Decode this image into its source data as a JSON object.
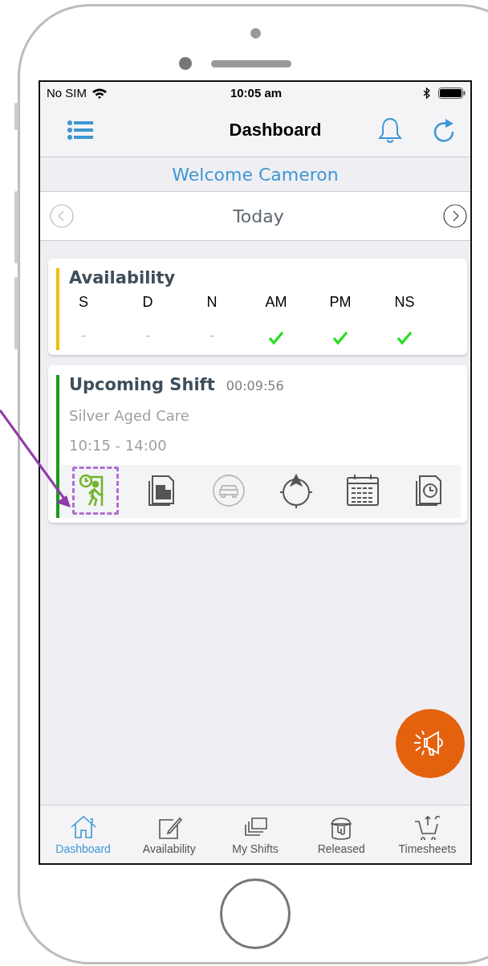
{
  "status_bar": {
    "carrier": "No SIM",
    "time": "10:05 am"
  },
  "nav_bar": {
    "title": "Dashboard"
  },
  "welcome": "Welcome Cameron",
  "date_nav": {
    "label": "Today"
  },
  "availability": {
    "title": "Availability",
    "columns": [
      {
        "label": "S",
        "available": false,
        "mark": "-"
      },
      {
        "label": "D",
        "available": false,
        "mark": "-"
      },
      {
        "label": "N",
        "available": false,
        "mark": "-"
      },
      {
        "label": "AM",
        "available": true
      },
      {
        "label": "PM",
        "available": true
      },
      {
        "label": "NS",
        "available": true
      }
    ]
  },
  "upcoming_shift": {
    "title": "Upcoming Shift",
    "countdown": "00:09:56",
    "location": "Silver Aged Care",
    "time": "10:15 - 14:00",
    "actions": [
      {
        "kind": "check-in",
        "disabled": false,
        "highlighted": true
      },
      {
        "kind": "documents",
        "disabled": false,
        "highlighted": false
      },
      {
        "kind": "car",
        "disabled": true,
        "highlighted": false
      },
      {
        "kind": "navigate",
        "disabled": false,
        "highlighted": false
      },
      {
        "kind": "calendar",
        "disabled": false,
        "highlighted": false
      },
      {
        "kind": "timesheet",
        "disabled": false,
        "highlighted": false
      }
    ]
  },
  "tabs": [
    {
      "label": "Dashboard",
      "kind": "home",
      "selected": true
    },
    {
      "label": "Availability",
      "kind": "edit",
      "selected": false
    },
    {
      "label": "My Shifts",
      "kind": "shifts",
      "selected": false
    },
    {
      "label": "Released",
      "kind": "bucket",
      "selected": false
    },
    {
      "label": "Timesheets",
      "kind": "cart",
      "selected": false
    }
  ]
}
